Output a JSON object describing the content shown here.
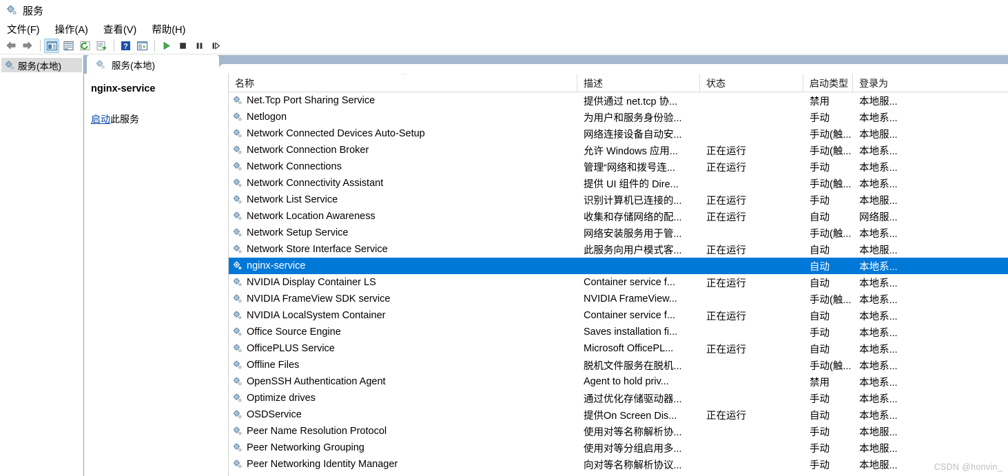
{
  "window": {
    "title": "服务",
    "icon": "services-gear-icon"
  },
  "menubar": {
    "items": [
      {
        "label": "文件(F)",
        "name": "menu-file"
      },
      {
        "label": "操作(A)",
        "name": "menu-action"
      },
      {
        "label": "查看(V)",
        "name": "menu-view"
      },
      {
        "label": "帮助(H)",
        "name": "menu-help"
      }
    ]
  },
  "toolbar": {
    "buttons": [
      {
        "name": "back-icon"
      },
      {
        "name": "forward-icon"
      },
      {
        "name": "show-hide-tree-icon"
      },
      {
        "name": "properties-icon"
      },
      {
        "name": "refresh-icon"
      },
      {
        "name": "export-list-icon"
      },
      {
        "name": "help-icon"
      },
      {
        "name": "show-action-pane-icon"
      },
      {
        "name": "start-service-icon"
      },
      {
        "name": "stop-service-icon"
      },
      {
        "name": "pause-service-icon"
      },
      {
        "name": "restart-service-icon"
      }
    ]
  },
  "tree": {
    "items": [
      {
        "label": "服务(本地)",
        "name": "tree-item-services-local",
        "selected": true
      }
    ]
  },
  "tab": {
    "label": "服务(本地)"
  },
  "details": {
    "service_name": "nginx-service",
    "action_link": "启动",
    "action_rest": "此服务"
  },
  "list": {
    "columns": [
      {
        "key": "name",
        "label": "名称",
        "sort": "asc"
      },
      {
        "key": "desc",
        "label": "描述"
      },
      {
        "key": "status",
        "label": "状态"
      },
      {
        "key": "start",
        "label": "启动类型"
      },
      {
        "key": "logon",
        "label": "登录为"
      }
    ],
    "rows": [
      {
        "name": "Net.Tcp Port Sharing Service",
        "desc": "提供通过 net.tcp 协...",
        "status": "",
        "start": "禁用",
        "logon": "本地服...",
        "selected": false
      },
      {
        "name": "Netlogon",
        "desc": "为用户和服务身份验...",
        "status": "",
        "start": "手动",
        "logon": "本地系...",
        "selected": false
      },
      {
        "name": "Network Connected Devices Auto-Setup",
        "desc": "网络连接设备自动安...",
        "status": "",
        "start": "手动(触...",
        "logon": "本地服...",
        "selected": false
      },
      {
        "name": "Network Connection Broker",
        "desc": "允许 Windows 应用...",
        "status": "正在运行",
        "start": "手动(触...",
        "logon": "本地系...",
        "selected": false
      },
      {
        "name": "Network Connections",
        "desc": "管理“网络和拨号连...",
        "status": "正在运行",
        "start": "手动",
        "logon": "本地系...",
        "selected": false
      },
      {
        "name": "Network Connectivity Assistant",
        "desc": "提供 UI 组件的 Dire...",
        "status": "",
        "start": "手动(触...",
        "logon": "本地系...",
        "selected": false
      },
      {
        "name": "Network List Service",
        "desc": "识别计算机已连接的...",
        "status": "正在运行",
        "start": "手动",
        "logon": "本地服...",
        "selected": false
      },
      {
        "name": "Network Location Awareness",
        "desc": "收集和存储网络的配...",
        "status": "正在运行",
        "start": "自动",
        "logon": "网络服...",
        "selected": false
      },
      {
        "name": "Network Setup Service",
        "desc": "网络安装服务用于管...",
        "status": "",
        "start": "手动(触...",
        "logon": "本地系...",
        "selected": false
      },
      {
        "name": "Network Store Interface Service",
        "desc": "此服务向用户模式客...",
        "status": "正在运行",
        "start": "自动",
        "logon": "本地服...",
        "selected": false
      },
      {
        "name": "nginx-service",
        "desc": "",
        "status": "",
        "start": "自动",
        "logon": "本地系...",
        "selected": true
      },
      {
        "name": "NVIDIA Display Container LS",
        "desc": "Container service f...",
        "status": "正在运行",
        "start": "自动",
        "logon": "本地系...",
        "selected": false
      },
      {
        "name": "NVIDIA FrameView SDK service",
        "desc": "NVIDIA FrameView...",
        "status": "",
        "start": "手动(触...",
        "logon": "本地系...",
        "selected": false
      },
      {
        "name": "NVIDIA LocalSystem Container",
        "desc": "Container service f...",
        "status": "正在运行",
        "start": "自动",
        "logon": "本地系...",
        "selected": false
      },
      {
        "name": "Office  Source Engine",
        "desc": "Saves installation fi...",
        "status": "",
        "start": "手动",
        "logon": "本地系...",
        "selected": false
      },
      {
        "name": "OfficePLUS Service",
        "desc": "Microsoft OfficePL...",
        "status": "正在运行",
        "start": "自动",
        "logon": "本地系...",
        "selected": false
      },
      {
        "name": "Offline Files",
        "desc": "脱机文件服务在脱机...",
        "status": "",
        "start": "手动(触...",
        "logon": "本地系...",
        "selected": false
      },
      {
        "name": "OpenSSH Authentication Agent",
        "desc": "Agent to hold priv...",
        "status": "",
        "start": "禁用",
        "logon": "本地系...",
        "selected": false
      },
      {
        "name": "Optimize drives",
        "desc": "通过优化存储驱动器...",
        "status": "",
        "start": "手动",
        "logon": "本地系...",
        "selected": false
      },
      {
        "name": "OSDService",
        "desc": "提供On Screen Dis...",
        "status": "正在运行",
        "start": "自动",
        "logon": "本地系...",
        "selected": false
      },
      {
        "name": "Peer Name Resolution Protocol",
        "desc": "使用对等名称解析协...",
        "status": "",
        "start": "手动",
        "logon": "本地服...",
        "selected": false
      },
      {
        "name": "Peer Networking Grouping",
        "desc": "使用对等分组启用多...",
        "status": "",
        "start": "手动",
        "logon": "本地服...",
        "selected": false
      },
      {
        "name": "Peer Networking Identity Manager",
        "desc": "向对等名称解析协议...",
        "status": "",
        "start": "手动",
        "logon": "本地服...",
        "selected": false
      }
    ]
  },
  "watermark": "CSDN @honvin_",
  "colors": {
    "selection": "#0078d7",
    "tabstrip": "#a4b7cd",
    "link": "#0645ad",
    "tree_selected": "#dcdcdc"
  }
}
